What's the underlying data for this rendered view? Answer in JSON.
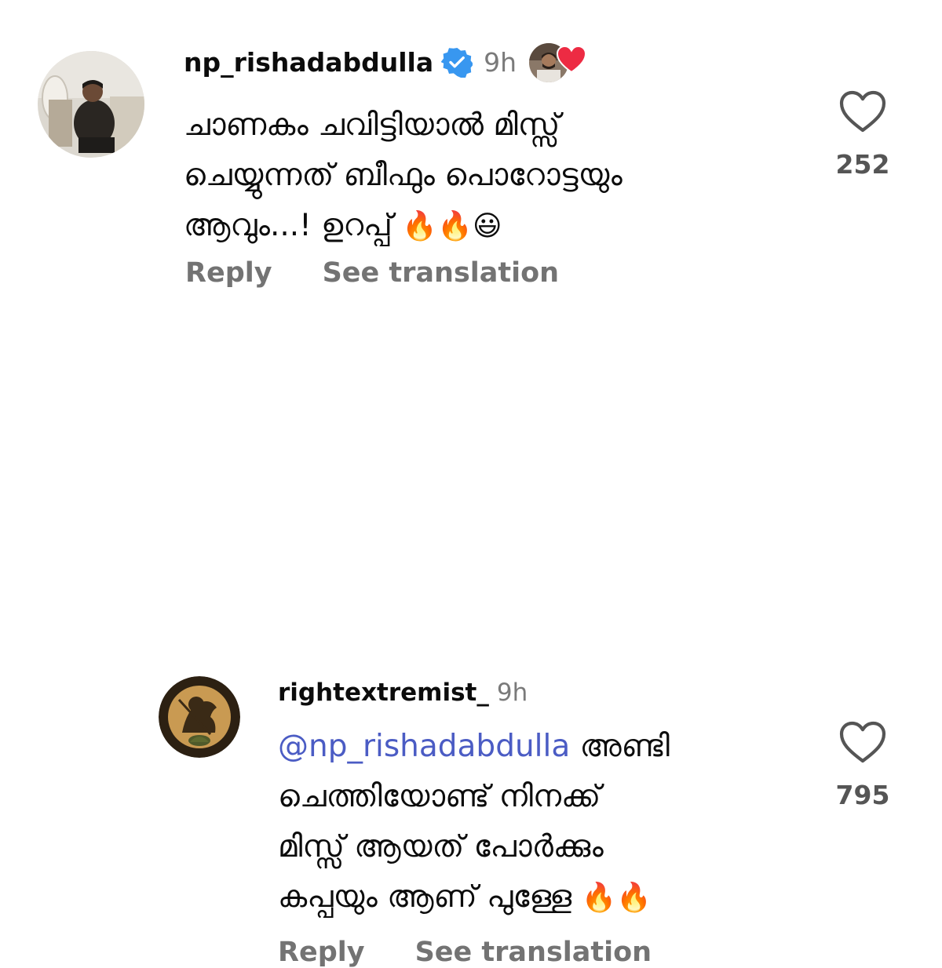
{
  "comments": [
    {
      "username": "np_rishadabdulla",
      "verified": true,
      "time": "9h",
      "liked_by_creator": true,
      "lines": [
        "ചാണകം ചവിട്ടിയാൽ മിസ്സ്",
        "ചെയ്യുന്നത് ബീഫും പൊറോട്ടയും",
        "ആവും...! ഉറപ്പ്"
      ],
      "line3_emoji": "🔥🔥😃",
      "reply_label": "Reply",
      "translate_label": "See translation",
      "like_count": "252"
    },
    {
      "username": "rightextremist_",
      "verified": false,
      "time": "9h",
      "mention": "@np_rishadabdulla",
      "lines": [
        "അണ്ടി",
        "ചെത്തിയോണ്ട് നിനക്ക്",
        "മിസ്സ് ആയത് പോർക്കും",
        "കപ്പയും ആണ് പുള്ളേ"
      ],
      "line4_emoji": "🔥🔥",
      "reply_label": "Reply",
      "translate_label": "See translation",
      "like_count": "795"
    }
  ],
  "colors": {
    "username": "#0c0c0c",
    "meta": "#737373",
    "mention": "#4b5cc4",
    "verified": "#3897f0",
    "heart_red": "#ed2b43"
  },
  "icons": [
    "verified-badge-icon",
    "heart-outline-icon",
    "liked-by-creator-heart-icon"
  ]
}
